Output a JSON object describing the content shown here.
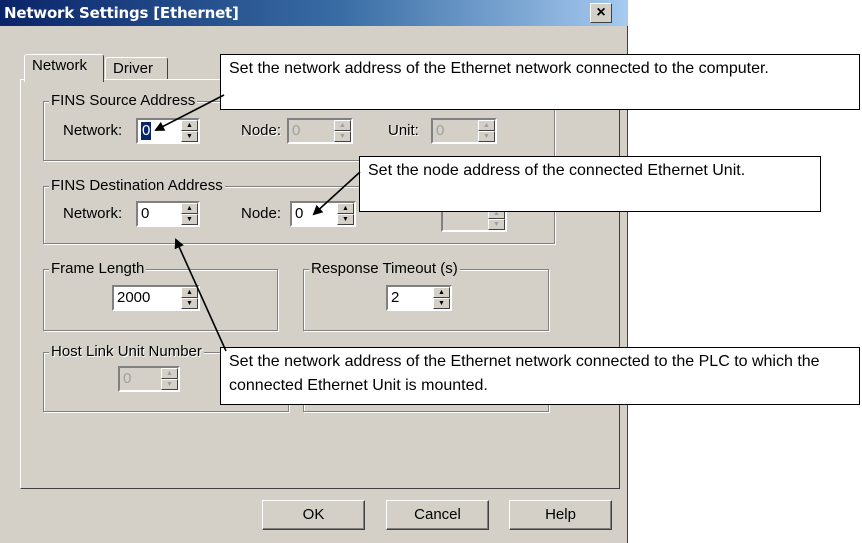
{
  "window": {
    "title": "Network Settings [Ethernet]",
    "close_label": "×"
  },
  "tabs": [
    {
      "label": "Network",
      "active": true
    },
    {
      "label": "Driver",
      "active": false
    }
  ],
  "fins_source": {
    "legend": "FINS Source Address",
    "network_label": "Network:",
    "network_value": "0",
    "node_label": "Node:",
    "node_value": "0",
    "unit_label": "Unit:",
    "unit_value": "0"
  },
  "fins_destination": {
    "legend": "FINS Destination Address",
    "network_label": "Network:",
    "network_value": "0",
    "node_label": "Node:",
    "node_value": "0",
    "unit_value": ""
  },
  "frame_length": {
    "legend": "Frame Length",
    "value": "2000"
  },
  "response_timeout": {
    "legend": "Response Timeout (s)",
    "value": "2"
  },
  "host_link": {
    "legend": "Host Link Unit Number",
    "value": "0"
  },
  "buttons": {
    "ok": "OK",
    "cancel": "Cancel",
    "help": "Help"
  },
  "callouts": {
    "source_network": "Set the network address of the Ethernet network connected to the computer.",
    "dest_node": "Set the node address of the connected Ethernet Unit.",
    "dest_network": "Set the network address of the Ethernet network connected to the PLC to which the connected Ethernet Unit is mounted."
  },
  "icons": {
    "spin_up": "▲",
    "spin_down": "▼"
  }
}
